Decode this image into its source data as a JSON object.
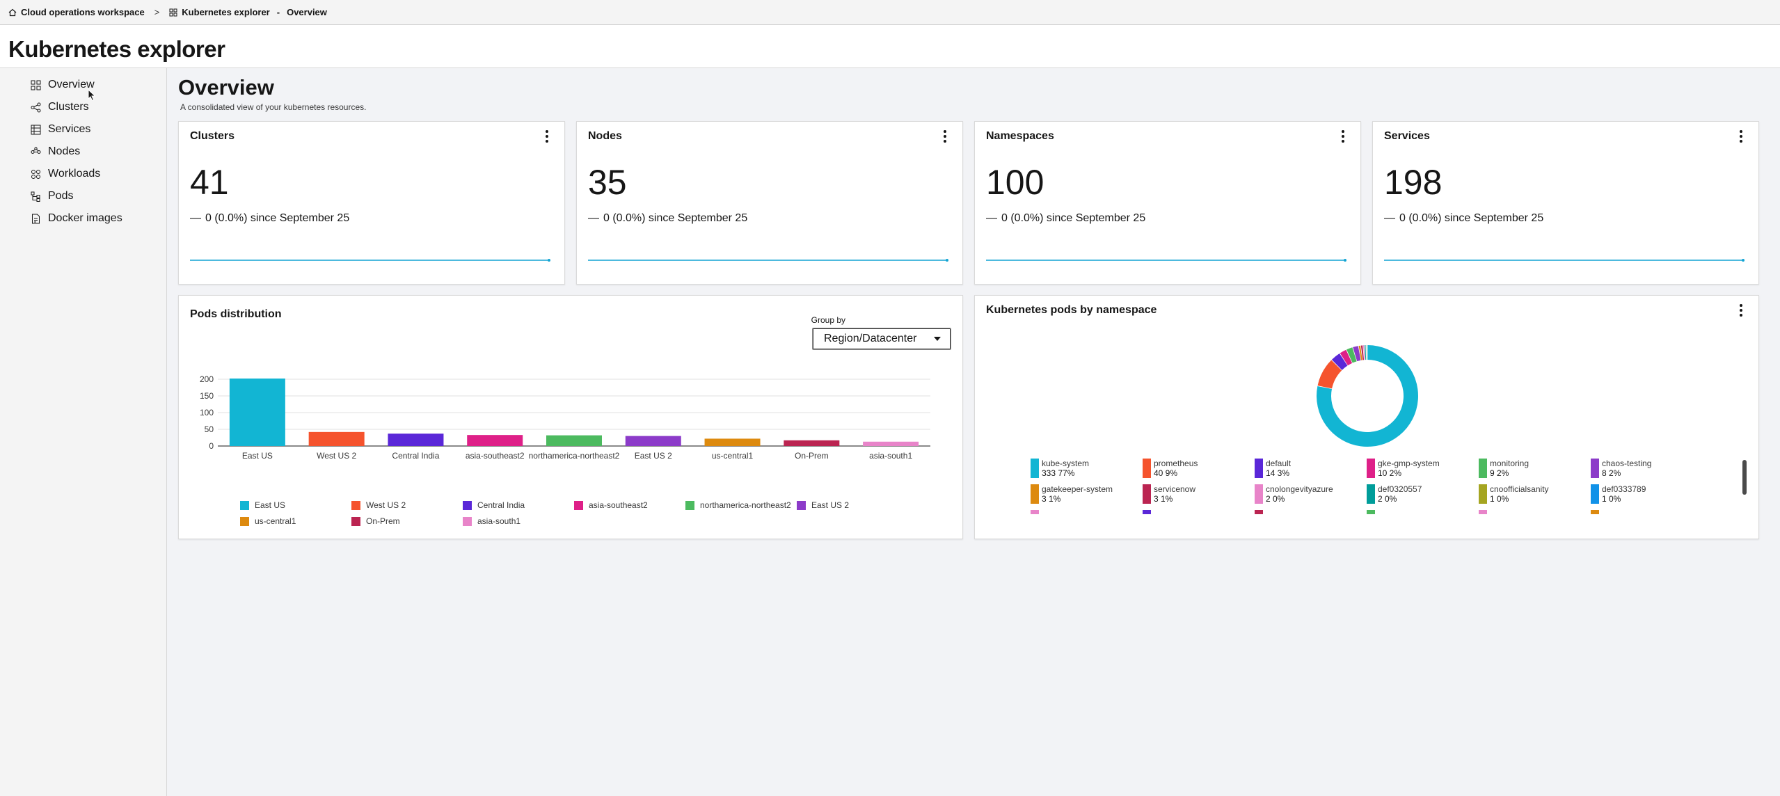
{
  "breadcrumb": {
    "home": "Cloud operations workspace",
    "separator": ">",
    "section": "Kubernetes explorer",
    "dot": "-",
    "page": "Overview"
  },
  "app": {
    "title": "Kubernetes explorer"
  },
  "sidebar": {
    "items": [
      {
        "label": "Overview",
        "icon": "grid-icon"
      },
      {
        "label": "Clusters",
        "icon": "share-icon"
      },
      {
        "label": "Services",
        "icon": "table-icon"
      },
      {
        "label": "Nodes",
        "icon": "network-icon"
      },
      {
        "label": "Workloads",
        "icon": "apps-icon"
      },
      {
        "label": "Pods",
        "icon": "tree-icon"
      },
      {
        "label": "Docker images",
        "icon": "document-icon"
      }
    ]
  },
  "main": {
    "title": "Overview",
    "subtitle": "A consolidated view of your kubernetes resources."
  },
  "metrics": [
    {
      "title": "Clusters",
      "value": "41",
      "dash": "—",
      "change": "0 (0.0%) since September 25"
    },
    {
      "title": "Nodes",
      "value": "35",
      "dash": "—",
      "change": "0 (0.0%) since September 25"
    },
    {
      "title": "Namespaces",
      "value": "100",
      "dash": "—",
      "change": "0 (0.0%) since September 25"
    },
    {
      "title": "Services",
      "value": "198",
      "dash": "—",
      "change": "0 (0.0%) since September 25"
    }
  ],
  "pods_card": {
    "title": "Pods distribution",
    "groupby_label": "Group by",
    "groupby_value": "Region/Datacenter"
  },
  "ns_card": {
    "title": "Kubernetes pods by namespace"
  },
  "chart_data": [
    {
      "type": "bar",
      "title": "Pods distribution",
      "categories": [
        "East US",
        "West US 2",
        "Central India",
        "asia-southeast2",
        "northamerica-northeast2",
        "East US 2",
        "us-central1",
        "On-Prem",
        "asia-south1"
      ],
      "values": [
        202,
        42,
        37,
        33,
        32,
        30,
        22,
        17,
        13
      ],
      "colors": [
        "#12b5d3",
        "#f5532d",
        "#5a27d8",
        "#de2088",
        "#4cba5f",
        "#8c3bc9",
        "#dd8a0f",
        "#bb2451",
        "#e884c9"
      ],
      "ylim": [
        0,
        200
      ],
      "yticks": [
        0,
        50,
        100,
        150,
        200
      ],
      "grid": true,
      "legend": "bottom"
    },
    {
      "type": "pie",
      "title": "Kubernetes pods by namespace",
      "donut": true,
      "labels": [
        "kube-system",
        "prometheus",
        "default",
        "gke-gmp-system",
        "monitoring",
        "chaos-testing",
        "gatekeeper-system",
        "servicenow",
        "cnolongevityazure",
        "def0320557",
        "cnoofficialsanity",
        "def0333789"
      ],
      "values": [
        333,
        40,
        14,
        10,
        9,
        8,
        3,
        3,
        2,
        2,
        1,
        1
      ],
      "value_labels": [
        "333  77%",
        "40  9%",
        "14  3%",
        "10  2%",
        "9  2%",
        "8  2%",
        "3  1%",
        "3  1%",
        "2  0%",
        "2  0%",
        "1  0%",
        "1  0%"
      ],
      "colors": [
        "#12b5d3",
        "#f5532d",
        "#5a27d8",
        "#de2088",
        "#4cba5f",
        "#8c3bc9",
        "#dd8a0f",
        "#bb2451",
        "#e884c9",
        "#009d9a",
        "#a5a521",
        "#1192e8"
      ],
      "legend": "bottom"
    }
  ]
}
